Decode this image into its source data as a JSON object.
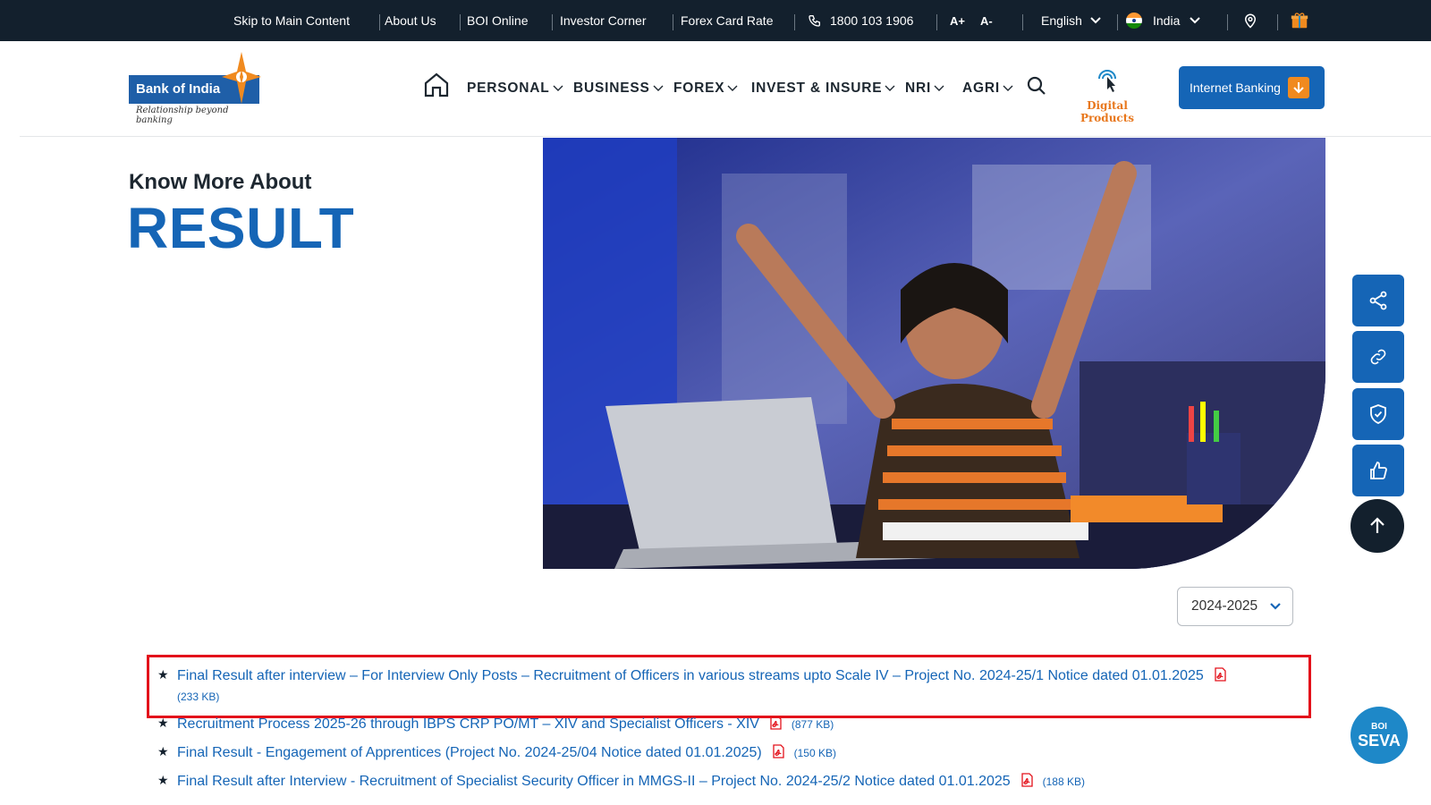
{
  "topbar": {
    "skip": "Skip to Main Content",
    "about": "About Us",
    "boi_online": "BOI Online",
    "investor": "Investor Corner",
    "forex_rate": "Forex Card Rate",
    "phone": "1800 103 1906",
    "font_increase": "A+",
    "font_decrease": "A-",
    "language": "English",
    "country": "India"
  },
  "logo": {
    "name": "Bank of India",
    "tagline": "Relationship beyond banking"
  },
  "nav": {
    "items": [
      "PERSONAL",
      "BUSINESS",
      "FOREX",
      "INVEST & INSURE",
      "NRI",
      "AGRI"
    ],
    "digital": "Digital Products",
    "internet_banking": "Internet Banking"
  },
  "hero": {
    "subtitle": "Know More About",
    "title": "RESULT"
  },
  "year_select": {
    "value": "2024-2025"
  },
  "results": [
    {
      "text": "Final Result after interview – For Interview Only Posts – Recruitment of Officers in various streams upto Scale IV – Project No. 2024-25/1 Notice dated 01.01.2025",
      "size": "(233 KB)"
    },
    {
      "text": "Recruitment Process 2025-26 through IBPS CRP PO/MT – XIV and Specialist Officers - XIV",
      "size": "(877 KB)"
    },
    {
      "text": "Final Result - Engagement of Apprentices (Project No. 2024-25/04 Notice dated 01.01.2025)",
      "size": "(150 KB)"
    },
    {
      "text": "Final Result after Interview - Recruitment of Specialist Security Officer in MMGS-II – Project No. 2024-25/2 Notice dated 01.01.2025",
      "size": "(188 KB)"
    }
  ],
  "seva": {
    "line1": "BOI",
    "line2": "SEVA"
  },
  "colors": {
    "brand_blue": "#1565b6",
    "dark": "#13202d",
    "accent_orange": "#f08a1f",
    "highlight_red": "#e3121b"
  }
}
